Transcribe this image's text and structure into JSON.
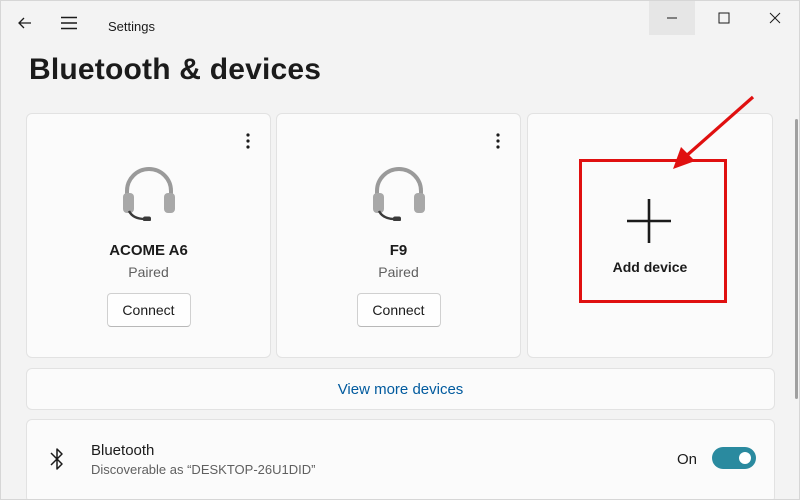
{
  "window": {
    "app_title": "Settings"
  },
  "page": {
    "title": "Bluetooth & devices"
  },
  "devices": [
    {
      "name": "ACOME A6",
      "status": "Paired",
      "action_label": "Connect",
      "icon": "headphones-icon"
    },
    {
      "name": "F9",
      "status": "Paired",
      "action_label": "Connect",
      "icon": "headphones-icon"
    }
  ],
  "add_device": {
    "label": "Add device",
    "icon": "plus-icon"
  },
  "view_more": {
    "label": "View more devices"
  },
  "bluetooth": {
    "title": "Bluetooth",
    "subtitle": "Discoverable as “DESKTOP-26U1DID”",
    "toggle_state_label": "On",
    "toggle_on": true
  },
  "colors": {
    "accent": "#2a8a9f",
    "link": "#005a9e",
    "annotation": "#e01010"
  }
}
